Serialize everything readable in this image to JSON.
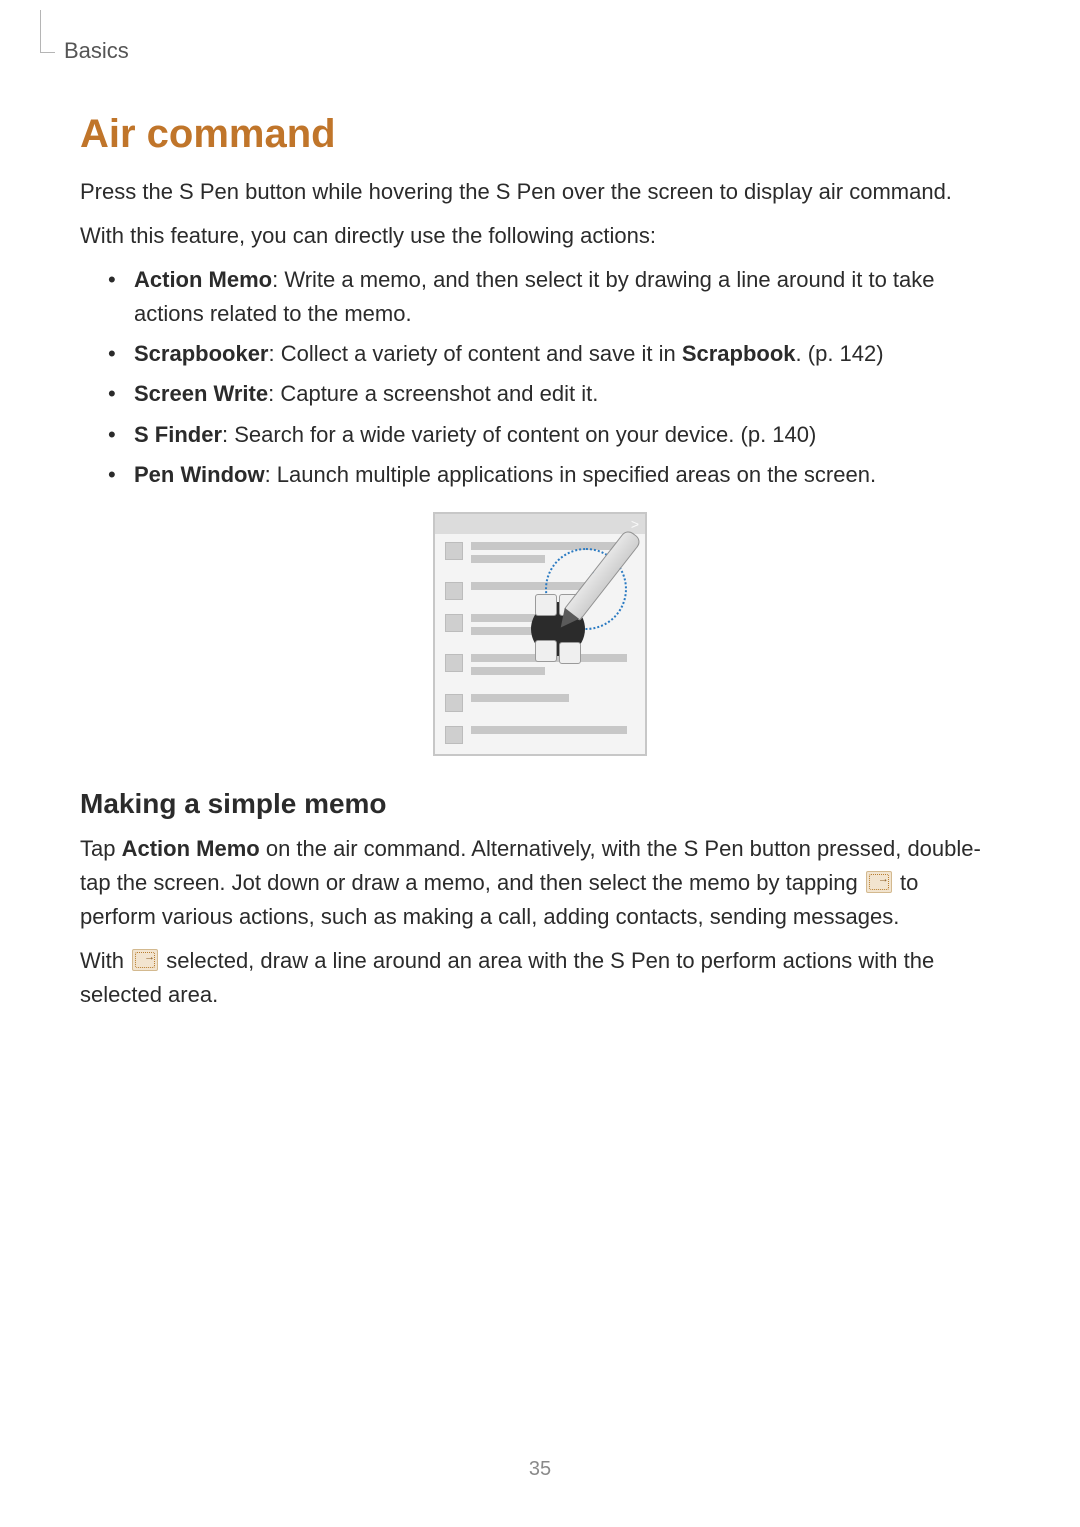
{
  "header": {
    "breadcrumb": "Basics"
  },
  "section": {
    "title": "Air command",
    "intro_1": "Press the S Pen button while hovering the S Pen over the screen to display air command.",
    "intro_2": "With this feature, you can directly use the following actions:"
  },
  "features": [
    {
      "name": "Action Memo",
      "desc": ": Write a memo, and then select it by drawing a line around it to take actions related to the memo."
    },
    {
      "name": "Scrapbooker",
      "desc_a": ": Collect a variety of content and save it in ",
      "ref": "Scrapbook",
      "desc_b": ". (p. 142)"
    },
    {
      "name": "Screen Write",
      "desc": ": Capture a screenshot and edit it."
    },
    {
      "name": "S Finder",
      "desc": ": Search for a wide variety of content on your device. (p. 140)"
    },
    {
      "name": "Pen Window",
      "desc": ": Launch multiple applications in specified areas on the screen."
    }
  ],
  "subsection": {
    "title": "Making a simple memo",
    "p1_a": "Tap ",
    "p1_bold": "Action Memo",
    "p1_b": " on the air command. Alternatively, with the S Pen button pressed, double-tap the screen. Jot down or draw a memo, and then select the memo by tapping ",
    "p1_c": " to perform various actions, such as making a call, adding contacts, sending messages.",
    "p2_a": "With ",
    "p2_b": " selected, draw a line around an area with the S Pen to perform actions with the selected area."
  },
  "page_number": "35"
}
